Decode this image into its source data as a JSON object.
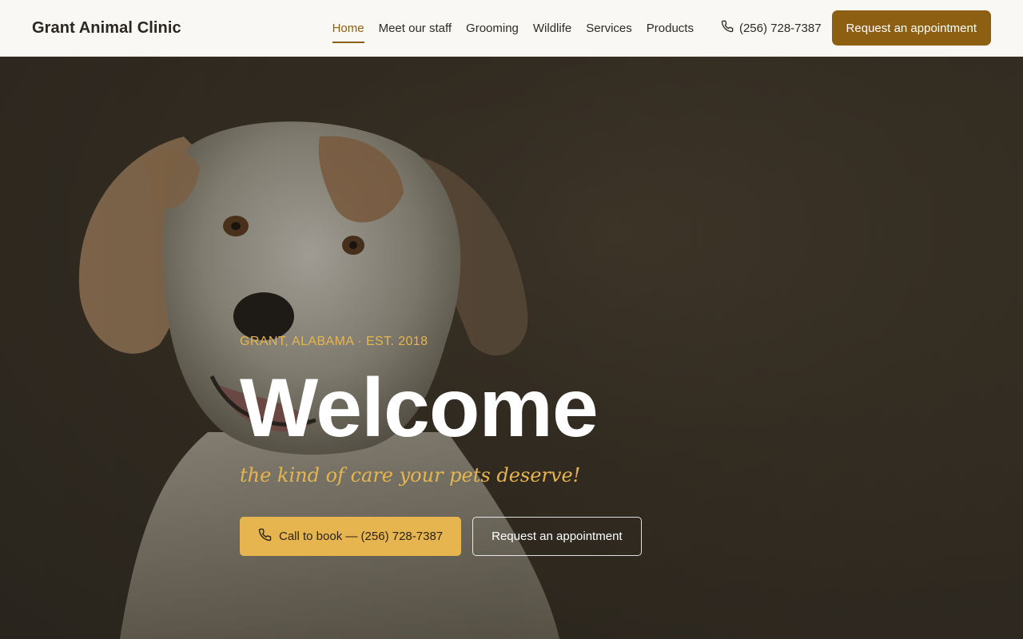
{
  "header": {
    "brand": "Grant Animal Clinic",
    "nav": [
      {
        "label": "Home",
        "active": true
      },
      {
        "label": "Meet our staff"
      },
      {
        "label": "Grooming"
      },
      {
        "label": "Wildlife"
      },
      {
        "label": "Services"
      },
      {
        "label": "Products"
      }
    ],
    "phone": "(256) 728-7387",
    "appointment_button": "Request an appointment"
  },
  "hero": {
    "eyebrow": "GRANT, ALABAMA · EST. 2018",
    "title": "Welcome",
    "tagline": "the kind of care your pets deserve!",
    "call_button": "Call to book — (256) 728-7387",
    "appointment_button": "Request an appointment",
    "image": "dog-photo"
  },
  "colors": {
    "accent": "#8c5f12",
    "gold": "#e7b550",
    "header_bg": "#f9f8f5",
    "hero_bg": "#332c22"
  },
  "icons": {
    "phone": "phone-icon"
  }
}
